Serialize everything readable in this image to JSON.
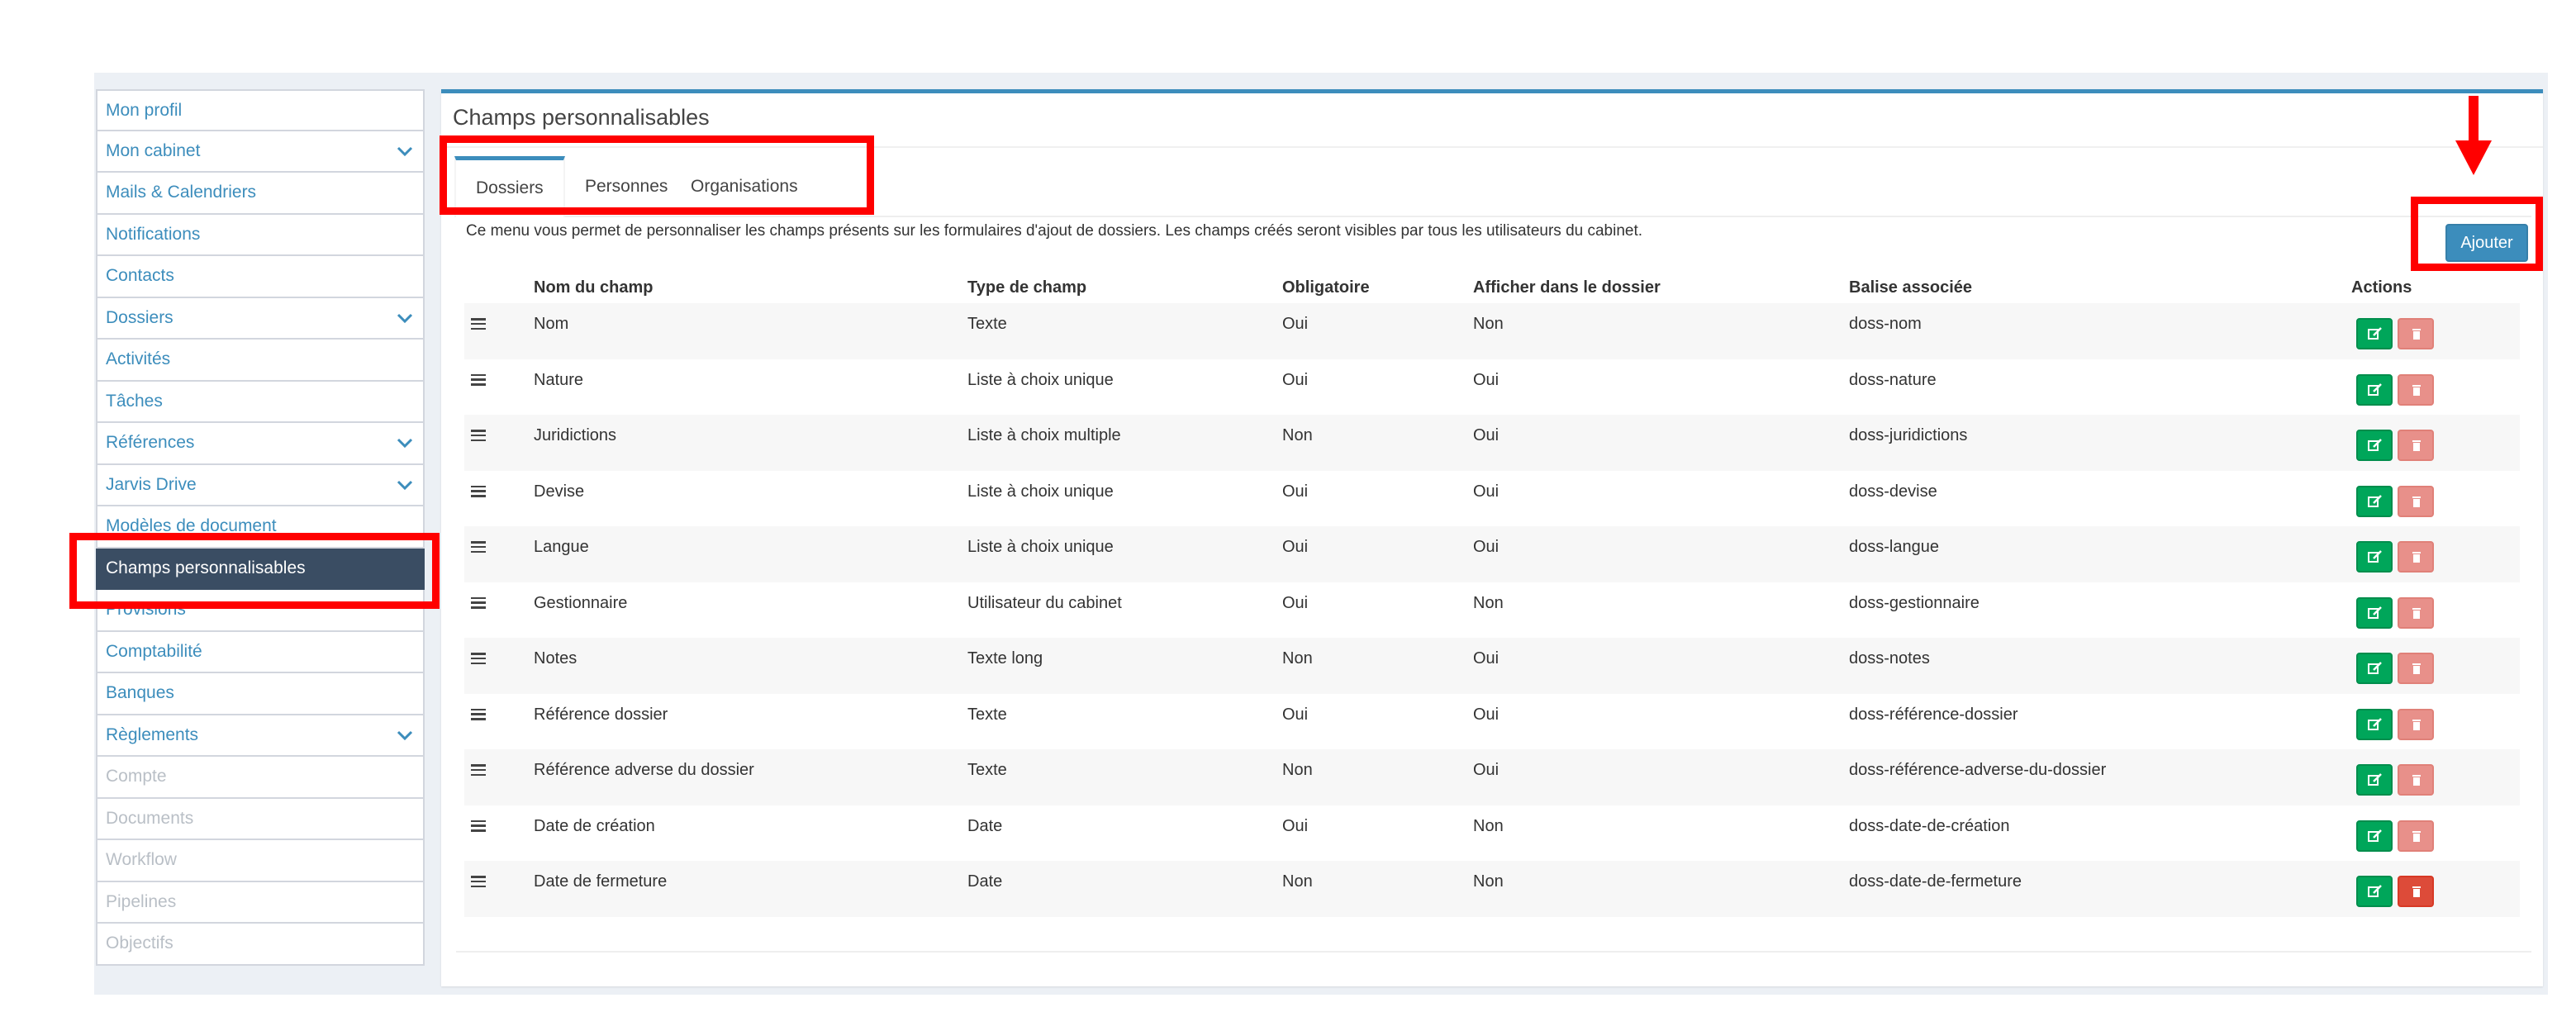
{
  "sidebar": {
    "items": [
      {
        "label": "Mon profil",
        "chevron": false,
        "state": "normal"
      },
      {
        "label": "Mon cabinet",
        "chevron": true,
        "state": "normal"
      },
      {
        "label": "Mails & Calendriers",
        "chevron": false,
        "state": "normal"
      },
      {
        "label": "Notifications",
        "chevron": false,
        "state": "normal"
      },
      {
        "label": "Contacts",
        "chevron": false,
        "state": "normal"
      },
      {
        "label": "Dossiers",
        "chevron": true,
        "state": "normal"
      },
      {
        "label": "Activités",
        "chevron": false,
        "state": "normal"
      },
      {
        "label": "Tâches",
        "chevron": false,
        "state": "normal"
      },
      {
        "label": "Références",
        "chevron": true,
        "state": "normal"
      },
      {
        "label": "Jarvis Drive",
        "chevron": true,
        "state": "normal"
      },
      {
        "label": "Modèles de document",
        "chevron": false,
        "state": "normal"
      },
      {
        "label": "Champs personnalisables",
        "chevron": false,
        "state": "active"
      },
      {
        "label": "Provisions",
        "chevron": false,
        "state": "normal"
      },
      {
        "label": "Comptabilité",
        "chevron": false,
        "state": "normal"
      },
      {
        "label": "Banques",
        "chevron": false,
        "state": "normal"
      },
      {
        "label": "Règlements",
        "chevron": true,
        "state": "normal"
      },
      {
        "label": "Compte",
        "chevron": false,
        "state": "disabled"
      },
      {
        "label": "Documents",
        "chevron": false,
        "state": "disabled"
      },
      {
        "label": "Workflow",
        "chevron": false,
        "state": "disabled"
      },
      {
        "label": "Pipelines",
        "chevron": false,
        "state": "disabled"
      },
      {
        "label": "Objectifs",
        "chevron": false,
        "state": "disabled"
      }
    ]
  },
  "main": {
    "title": "Champs personnalisables",
    "tabs": [
      "Dossiers",
      "Personnes",
      "Organisations"
    ],
    "active_tab": "Dossiers",
    "description": "Ce menu vous permet de personnaliser les champs présents sur les formulaires d'ajout de dossiers. Les champs créés seront visibles par tous les utilisateurs du cabinet.",
    "add_button": "Ajouter",
    "columns": [
      "Nom du champ",
      "Type de champ",
      "Obligatoire",
      "Afficher dans le dossier",
      "Balise associée",
      "Actions"
    ],
    "rows": [
      {
        "name": "Nom",
        "type": "Texte",
        "required": "Oui",
        "display": "Non",
        "tag": "doss-nom",
        "delete_enabled": false
      },
      {
        "name": "Nature",
        "type": "Liste à choix unique",
        "required": "Oui",
        "display": "Oui",
        "tag": "doss-nature",
        "delete_enabled": false
      },
      {
        "name": "Juridictions",
        "type": "Liste à choix multiple",
        "required": "Non",
        "display": "Oui",
        "tag": "doss-juridictions",
        "delete_enabled": false
      },
      {
        "name": "Devise",
        "type": "Liste à choix unique",
        "required": "Oui",
        "display": "Oui",
        "tag": "doss-devise",
        "delete_enabled": false
      },
      {
        "name": "Langue",
        "type": "Liste à choix unique",
        "required": "Oui",
        "display": "Oui",
        "tag": "doss-langue",
        "delete_enabled": false
      },
      {
        "name": "Gestionnaire",
        "type": "Utilisateur du cabinet",
        "required": "Oui",
        "display": "Non",
        "tag": "doss-gestionnaire",
        "delete_enabled": false
      },
      {
        "name": "Notes",
        "type": "Texte long",
        "required": "Non",
        "display": "Oui",
        "tag": "doss-notes",
        "delete_enabled": false
      },
      {
        "name": "Référence dossier",
        "type": "Texte",
        "required": "Oui",
        "display": "Oui",
        "tag": "doss-référence-dossier",
        "delete_enabled": false
      },
      {
        "name": "Référence adverse du dossier",
        "type": "Texte",
        "required": "Non",
        "display": "Oui",
        "tag": "doss-référence-adverse-du-dossier",
        "delete_enabled": false
      },
      {
        "name": "Date de création",
        "type": "Date",
        "required": "Oui",
        "display": "Non",
        "tag": "doss-date-de-création",
        "delete_enabled": false
      },
      {
        "name": "Date de fermeture",
        "type": "Date",
        "required": "Non",
        "display": "Non",
        "tag": "doss-date-de-fermeture",
        "delete_enabled": true
      }
    ]
  },
  "icons": {
    "chevron": "chevron-down-icon",
    "drag": "drag-handle-icon",
    "edit": "edit-icon",
    "delete": "trash-icon",
    "annotation_arrow": "down-arrow-icon"
  },
  "colors": {
    "accent": "#3c8dbc",
    "sidebar_active": "#3a4d63",
    "edit_button": "#00a65a",
    "delete_button": "#dd4b39",
    "annotation": "#ff0000"
  }
}
